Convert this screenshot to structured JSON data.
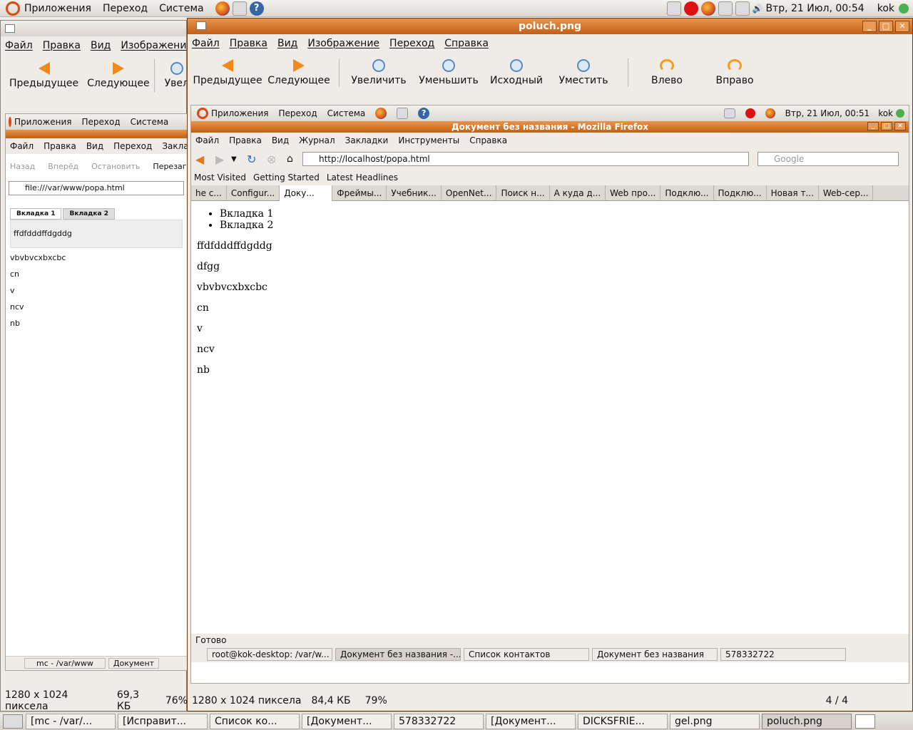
{
  "top_panel": {
    "menus": [
      "Приложения",
      "Переход",
      "Система"
    ],
    "clock": "Втр, 21 Июл, 00:54",
    "user": "kok"
  },
  "bg_window": {
    "menus": [
      "Файл",
      "Правка",
      "Вид",
      "Изображени"
    ],
    "toolbar": [
      "Предыдущее",
      "Следующее",
      "Увел"
    ],
    "inner_panel_menus": [
      "Приложения",
      "Переход",
      "Система"
    ],
    "inner_menus": [
      "Файл",
      "Правка",
      "Вид",
      "Переход",
      "Закладки"
    ],
    "inner_nav": [
      "Назад",
      "Вперёд",
      "Остановить",
      "Перезагр"
    ],
    "url": "file:///var/www/popa.html",
    "tabs": [
      "Вкладка 1",
      "Вкладка 2"
    ],
    "tab_content": "ffdfdddffdgddg",
    "lines": [
      "vbvbvcxbxcbc",
      "cn",
      "v",
      "ncv",
      "nb"
    ],
    "taskbar": [
      "mc - /var/www",
      "Документ"
    ],
    "status": {
      "dims": "1280 x 1024 пиксела",
      "size": "69,3 КБ",
      "zoom": "76%"
    }
  },
  "main_window": {
    "title": "poluch.png",
    "menus": [
      "Файл",
      "Правка",
      "Вид",
      "Изображение",
      "Переход",
      "Справка"
    ],
    "toolbar": [
      "Предыдущее",
      "Следующее",
      "Увеличить",
      "Уменьшить",
      "Исходный",
      "Уместить",
      "Влево",
      "Вправо"
    ],
    "status": {
      "dims": "1280 x 1024 пиксела",
      "size": "84,4 КБ",
      "zoom": "79%",
      "page": "4 / 4"
    }
  },
  "screenshot": {
    "panel_menus": [
      "Приложения",
      "Переход",
      "Система"
    ],
    "panel_clock": "Втр, 21 Июл, 00:51",
    "panel_user": "kok",
    "ff_title": "Документ без названия - Mozilla Firefox",
    "ff_menus": [
      "Файл",
      "Правка",
      "Вид",
      "Журнал",
      "Закладки",
      "Инструменты",
      "Справка"
    ],
    "url": "http://localhost/popa.html",
    "search_placeholder": "Google",
    "bookmarks": [
      "Most Visited",
      "Getting Started",
      "Latest Headlines"
    ],
    "tabs": [
      "he c...",
      "Configur...",
      "Доку...",
      "Фреймы...",
      "Учебник...",
      "OpenNet...",
      "Поиск н...",
      "А куда д...",
      "Web про...",
      "Подклю...",
      "Подклю...",
      "Новая т...",
      "Web-сер..."
    ],
    "list": [
      "Вкладка 1",
      "Вкладка 2"
    ],
    "paragraphs": [
      "ffdfdddffdgddg",
      "dfgg",
      "vbvbvcxbxcbc",
      "cn",
      "v",
      "ncv",
      "nb"
    ],
    "status": "Готово",
    "taskbar": [
      "root@kok-desktop: /var/w...",
      "Документ без названия -...",
      "Список контактов",
      "Документ без названия",
      "578332722"
    ]
  },
  "bottom_panel": {
    "tasks": [
      "[mc - /var/...",
      "[Исправит...",
      "Список ко...",
      "[Документ...",
      "578332722",
      "[Документ...",
      "DICKSFRIE...",
      "gel.png",
      "poluch.png"
    ]
  },
  "colors": {
    "title_active": "#c25f17",
    "accent_orange": "#f08a1a",
    "page_bg": "#ffffff"
  }
}
